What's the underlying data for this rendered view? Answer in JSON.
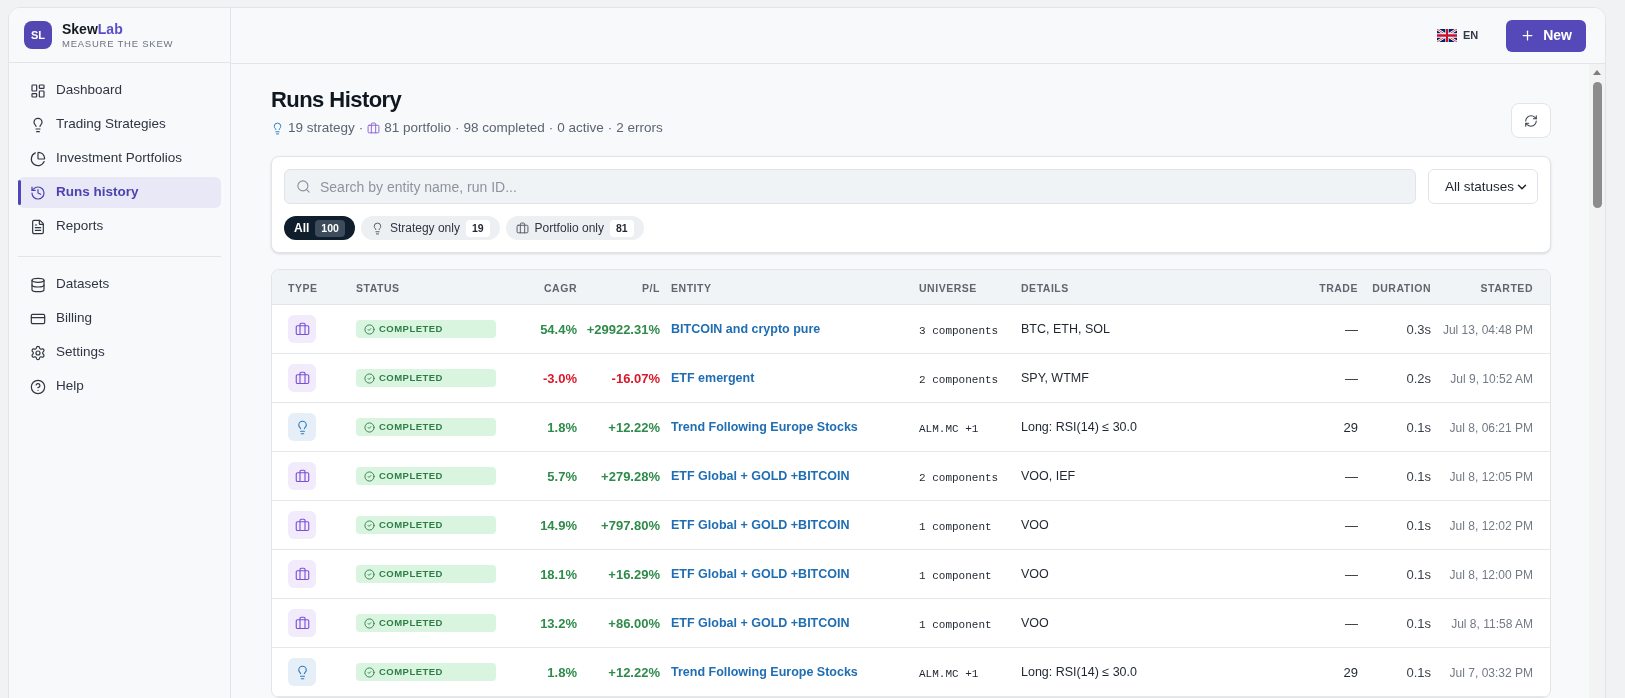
{
  "brand": {
    "logo": "SL",
    "name": "Skew",
    "name_accent": "Lab",
    "tagline": "MEASURE THE SKEW"
  },
  "sidebar": {
    "sections": [
      {
        "items": [
          {
            "label": "Dashboard",
            "selected": false
          },
          {
            "label": "Trading Strategies",
            "selected": false
          },
          {
            "label": "Investment Portfolios",
            "selected": false
          },
          {
            "label": "Runs history",
            "selected": true
          },
          {
            "label": "Reports",
            "selected": false
          }
        ]
      },
      {
        "items": [
          {
            "label": "Datasets",
            "selected": false
          },
          {
            "label": "Billing",
            "selected": false
          },
          {
            "label": "Settings",
            "selected": false
          },
          {
            "label": "Help",
            "selected": false
          }
        ]
      }
    ]
  },
  "top_bar": {
    "language": "EN",
    "new_button": "New"
  },
  "page": {
    "title": "Runs History",
    "summary": [
      {
        "kind": "strategy",
        "text": "19 strategy"
      },
      {
        "kind": "portfolio",
        "text": "81 portfolio"
      },
      {
        "kind": "plain",
        "text": "98 completed"
      },
      {
        "kind": "plain",
        "text": "0 active"
      },
      {
        "kind": "plain",
        "text": "2 errors"
      }
    ],
    "separators": [
      "·",
      "·",
      "·",
      "·"
    ]
  },
  "filters": {
    "search": {
      "placeholder": "Search by entity name, run ID..."
    },
    "status_select": "All statuses",
    "chips": [
      {
        "kind": "all",
        "label": "All",
        "count": "100",
        "selected": true
      },
      {
        "kind": "strategy",
        "label": "Strategy only",
        "count": "19",
        "selected": false
      },
      {
        "kind": "portfolio",
        "label": "Portfolio only",
        "count": "81",
        "selected": false
      }
    ]
  },
  "table": {
    "columns": [
      "TYPE",
      "STATUS",
      "CAGR",
      "P/L",
      "ENTITY",
      "UNIVERSE",
      "DETAILS",
      "TRADE",
      "DURATION",
      "STARTED"
    ],
    "rows": [
      {
        "kind": "portfolio",
        "status": {
          "kind": "completed",
          "label": "COMPLETED"
        },
        "cagr": "54.4%",
        "pl": "+29922.31%",
        "negative": false,
        "entity": "BITCOIN and crypto pure",
        "universe": "3 components",
        "details": "BTC, ETH, SOL",
        "trade": "—",
        "duration": "0.3s",
        "started": "Jul 13, 04:48 PM"
      },
      {
        "kind": "portfolio",
        "status": {
          "kind": "completed",
          "label": "COMPLETED"
        },
        "cagr": "-3.0%",
        "pl": "-16.07%",
        "negative": true,
        "entity": "ETF emergent",
        "universe": "2 components",
        "details": "SPY, WTMF",
        "trade": "—",
        "duration": "0.2s",
        "started": "Jul 9, 10:52 AM"
      },
      {
        "kind": "strategy",
        "status": {
          "kind": "completed",
          "label": "COMPLETED"
        },
        "cagr": "1.8%",
        "pl": "+12.22%",
        "negative": false,
        "entity": "Trend Following Europe Stocks",
        "universe": "ALM.MC +1",
        "details": "Long: RSI(14) ≤ 30.0",
        "trade": "29",
        "duration": "0.1s",
        "started": "Jul 8, 06:21 PM"
      },
      {
        "kind": "portfolio",
        "status": {
          "kind": "completed",
          "label": "COMPLETED"
        },
        "cagr": "5.7%",
        "pl": "+279.28%",
        "negative": false,
        "entity": "ETF Global + GOLD +BITCOIN",
        "universe": "2 components",
        "details": "VOO, IEF",
        "trade": "—",
        "duration": "0.1s",
        "started": "Jul 8, 12:05 PM"
      },
      {
        "kind": "portfolio",
        "status": {
          "kind": "completed",
          "label": "COMPLETED"
        },
        "cagr": "14.9%",
        "pl": "+797.80%",
        "negative": false,
        "entity": "ETF Global + GOLD +BITCOIN",
        "universe": "1 component",
        "details": "VOO",
        "trade": "—",
        "duration": "0.1s",
        "started": "Jul 8, 12:02 PM"
      },
      {
        "kind": "portfolio",
        "status": {
          "kind": "completed",
          "label": "COMPLETED"
        },
        "cagr": "18.1%",
        "pl": "+16.29%",
        "negative": false,
        "entity": "ETF Global + GOLD +BITCOIN",
        "universe": "1 component",
        "details": "VOO",
        "trade": "—",
        "duration": "0.1s",
        "started": "Jul 8, 12:00 PM"
      },
      {
        "kind": "portfolio",
        "status": {
          "kind": "completed",
          "label": "COMPLETED"
        },
        "cagr": "13.2%",
        "pl": "+86.00%",
        "negative": false,
        "entity": "ETF Global + GOLD +BITCOIN",
        "universe": "1 component",
        "details": "VOO",
        "trade": "—",
        "duration": "0.1s",
        "started": "Jul 8, 11:58 AM"
      },
      {
        "kind": "strategy",
        "status": {
          "kind": "completed",
          "label": "COMPLETED"
        },
        "cagr": "1.8%",
        "pl": "+12.22%",
        "negative": false,
        "entity": "Trend Following Europe Stocks",
        "universe": "ALM.MC +1",
        "details": "Long: RSI(14) ≤ 30.0",
        "trade": "29",
        "duration": "0.1s",
        "started": "Jul 7, 03:32 PM"
      }
    ]
  }
}
